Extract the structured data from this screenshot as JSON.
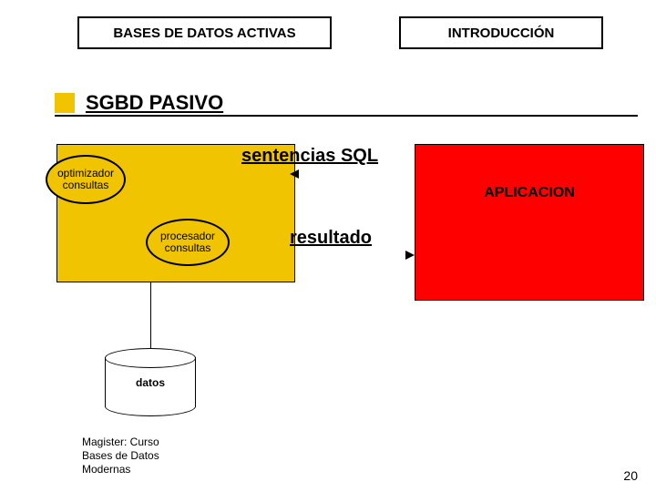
{
  "header": {
    "left_box": "BASES DE DATOS ACTIVAS",
    "right_box": "INTRODUCCIÓN"
  },
  "title": "SGBD  PASIVO",
  "db_box": {
    "optimizador": "optimizador\nconsultas",
    "procesador": "procesador\nconsultas"
  },
  "arrows": {
    "top_label": "sentencias SQL",
    "bottom_label": "resultado"
  },
  "app_box": {
    "label": "APLICACION"
  },
  "cylinder": {
    "label": "datos"
  },
  "footer": {
    "line1": "Magister: Curso",
    "line2": "Bases de Datos",
    "line3": "Modernas"
  },
  "page_number": "20"
}
